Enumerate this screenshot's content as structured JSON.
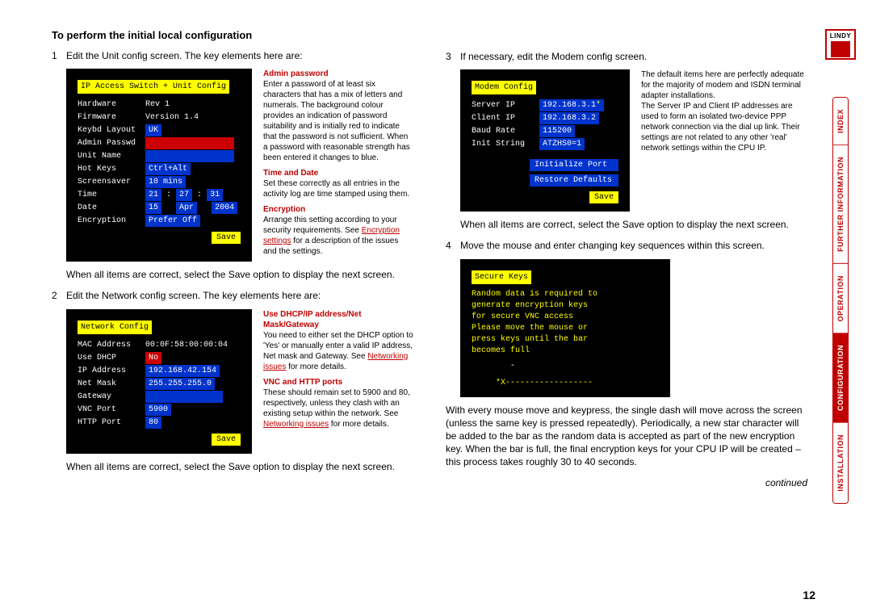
{
  "title": "To perform the initial local configuration",
  "steps": {
    "s1": "Edit the Unit config screen. The key elements here are:",
    "s2": "Edit the Network config screen. The key elements here are:",
    "s3": "If necessary, edit the Modem config screen.",
    "s4": "Move the mouse and enter changing key sequences within this screen."
  },
  "after_save": "When all items are correct, select the Save option to display the next screen.",
  "para_modem": "The default items here are perfectly adequate for the majority of modem and ISDN terminal adapter installations.\nThe Server IP and Client IP addresses are used to form an isolated two-device PPP network connection via the dial up link. Their settings are not related to any other 'real' network settings within the CPU IP.",
  "para_mouse": "With every mouse move and keypress, the single dash will move across the screen (unless the same key is pressed repeatedly). Periodically, a new star character will be added to the bar as the random data is accepted as part of the new encryption key. When the bar is full, the final encryption keys for your CPU IP will be created – this process takes roughly 30 to 40 seconds.",
  "continued": "continued",
  "pagenum": "12",
  "unit": {
    "title": "IP Access Switch + Unit Config",
    "rows": {
      "hardware_l": "Hardware",
      "hardware_v": "Rev 1",
      "firmware_l": "Firmware",
      "firmware_v": "Version 1.4",
      "keybd_l": "Keybd Layout",
      "keybd_v": "UK",
      "admin_l": "Admin Passwd",
      "unit_l": "Unit Name",
      "hot_l": "Hot Keys",
      "hot_v": "Ctrl+Alt",
      "ss_l": "Screensaver",
      "ss_v": "10 mins",
      "time_l": "Time",
      "time_h": "21",
      "time_m": "27",
      "time_s": "31",
      "date_l": "Date",
      "date_d": "15",
      "date_mo": "Apr",
      "date_y": "2004",
      "enc_l": "Encryption",
      "enc_v": "Prefer Off"
    },
    "save": "Save"
  },
  "unit_help": {
    "h1": "Admin password",
    "p1": "Enter a password of at least six characters that has a mix of letters and numerals. The background colour provides an indication of password suitability and is initially red to indicate that the password is not sufficient. When a password with reasonable strength has been entered it changes to blue.",
    "h2": "Time and Date",
    "p2": "Set these correctly as all entries in the activity log are time stamped using them.",
    "h3": "Encryption",
    "p3a": "Arrange this setting according to your security requirements. See ",
    "p3link": "Encryption settings",
    "p3b": " for a description of the issues and the settings."
  },
  "net": {
    "title": "Network Config",
    "rows": {
      "mac_l": "MAC Address",
      "mac_v": "00:0F:58:00:00:04",
      "dhcp_l": "Use DHCP",
      "dhcp_v": "No",
      "ip_l": "IP Address",
      "ip_v": "192.168.42.154",
      "mask_l": "Net Mask",
      "mask_v": "255.255.255.0",
      "gw_l": "Gateway",
      "vnc_l": "VNC Port",
      "vnc_v": "5900",
      "http_l": "HTTP Port",
      "http_v": "80"
    },
    "save": "Save"
  },
  "net_help": {
    "h1": "Use DHCP/IP address/Net Mask/Gateway",
    "p1a": "You need to either set the DHCP option to 'Yes' or manually enter a valid IP address, Net mask and Gateway. See ",
    "p1link": "Networking issues",
    "p1b": " for more details.",
    "h2": "VNC and HTTP ports",
    "p2a": "These should remain set to 5900 and 80, respectively, unless they clash with an existing setup within the network. See ",
    "p2link": "Networking issues",
    "p2b": " for more details."
  },
  "modem": {
    "title": "Modem Config",
    "rows": {
      "sip_l": "Server IP",
      "sip_v": "192.168.3.1",
      "cip_l": "Client IP",
      "cip_v": "192.168.3.2",
      "baud_l": "Baud Rate",
      "baud_v": "115200",
      "init_l": "Init String",
      "init_v": "ATZHS0=1"
    },
    "btn1": "Initialize Port",
    "btn2": "Restore Defaults",
    "save": "Save"
  },
  "secure": {
    "title": "Secure Keys",
    "msg": "Random data is required to\ngenerate encryption keys\nfor secure VNC access\nPlease move the mouse or\npress keys until the bar\nbecomes full",
    "bar": "*X------------------"
  },
  "logo": "LINDY",
  "nav": {
    "install": "INSTALLATION",
    "config": "CONFIGURATION",
    "oper": "OPERATION",
    "further": "FURTHER INFORMATION",
    "index": "INDEX"
  }
}
